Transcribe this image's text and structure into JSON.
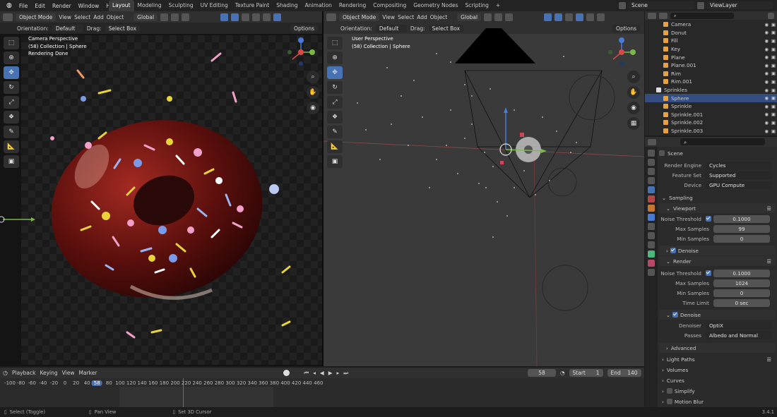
{
  "topbar": {
    "menus": [
      "File",
      "Edit",
      "Render",
      "Window",
      "Help"
    ],
    "workspaces": [
      "Layout",
      "Modeling",
      "Sculpting",
      "UV Editing",
      "Texture Paint",
      "Shading",
      "Animation",
      "Rendering",
      "Compositing",
      "Geometry Nodes",
      "Scripting"
    ],
    "add_tab": "+",
    "scene": "Scene",
    "viewlayer": "ViewLayer"
  },
  "viewport_left": {
    "mode": "Object Mode",
    "menus": [
      "View",
      "Select",
      "Add",
      "Object"
    ],
    "transform": "Global",
    "orientation_label": "Orientation:",
    "orientation_value": "Default",
    "drag_label": "Drag:",
    "drag_value": "Select Box",
    "options": "Options",
    "info1": "Camera Perspective",
    "info2": "(58) Collection | Sphere",
    "info3": "Rendering Done"
  },
  "viewport_right": {
    "mode": "Object Mode",
    "menus": [
      "View",
      "Select",
      "Add",
      "Object"
    ],
    "transform": "Global",
    "orientation_label": "Orientation:",
    "orientation_value": "Default",
    "drag_label": "Drag:",
    "drag_value": "Select Box",
    "options": "Options",
    "info1": "User Perspective",
    "info2": "(58) Collection | Sphere"
  },
  "outliner": {
    "items": [
      {
        "name": "Camera",
        "indent": 1
      },
      {
        "name": "Donut",
        "indent": 1
      },
      {
        "name": "Fill",
        "indent": 1
      },
      {
        "name": "Key",
        "indent": 1
      },
      {
        "name": "Plane",
        "indent": 1
      },
      {
        "name": "Plane.001",
        "indent": 1
      },
      {
        "name": "Rim",
        "indent": 1
      },
      {
        "name": "Rim.001",
        "indent": 1
      },
      {
        "name": "Sprinkles",
        "indent": 0
      },
      {
        "name": "Sphere",
        "indent": 1,
        "selected": true
      },
      {
        "name": "Sprinkle",
        "indent": 1
      },
      {
        "name": "Sprinkle.001",
        "indent": 1
      },
      {
        "name": "Sprinkle.002",
        "indent": 1
      },
      {
        "name": "Sprinkle.003",
        "indent": 1
      }
    ]
  },
  "properties": {
    "context": "Scene",
    "render_engine_label": "Render Engine",
    "render_engine": "Cycles",
    "feature_set_label": "Feature Set",
    "feature_set": "Supported",
    "device_label": "Device",
    "device": "GPU Compute",
    "sampling": "Sampling",
    "viewport": "Viewport",
    "noise_threshold_label": "Noise Threshold",
    "vp_noise": "0.1000",
    "max_samples_label": "Max Samples",
    "vp_max": "99",
    "min_samples_label": "Min Samples",
    "vp_min": "0",
    "denoise": "Denoise",
    "render": "Render",
    "r_noise": "0.1000",
    "r_max": "1024",
    "r_min": "0",
    "time_limit_label": "Time Limit",
    "time_limit": "0 sec",
    "denoiser_label": "Denoiser",
    "denoiser": "OptiX",
    "passes_label": "Passes",
    "passes": "Albedo and Normal",
    "advanced": "Advanced",
    "light_paths": "Light Paths",
    "volumes": "Volumes",
    "curves": "Curves",
    "simplify": "Simplify",
    "motion_blur": "Motion Blur"
  },
  "timeline": {
    "menus": [
      "Playback",
      "Keying",
      "View",
      "Marker"
    ],
    "current_frame": "58",
    "start_label": "Start",
    "start": "1",
    "end_label": "End",
    "end": "140",
    "ticks": [
      "-100",
      "-80",
      "-60",
      "-40",
      "-20",
      "0",
      "20",
      "40",
      "58",
      "80",
      "100",
      "120",
      "140",
      "160",
      "180",
      "200",
      "220",
      "240",
      "260",
      "280",
      "300",
      "320",
      "340",
      "360",
      "380",
      "400",
      "420",
      "440",
      "460"
    ]
  },
  "statusbar": {
    "select": "Select (Toggle)",
    "pan": "Pan View",
    "cursor": "Set 3D Cursor",
    "version": "3.4.1"
  },
  "colors": {
    "accent": "#4772b3",
    "selected_row": "#334d80",
    "chocolate": "#5a0f0c"
  }
}
